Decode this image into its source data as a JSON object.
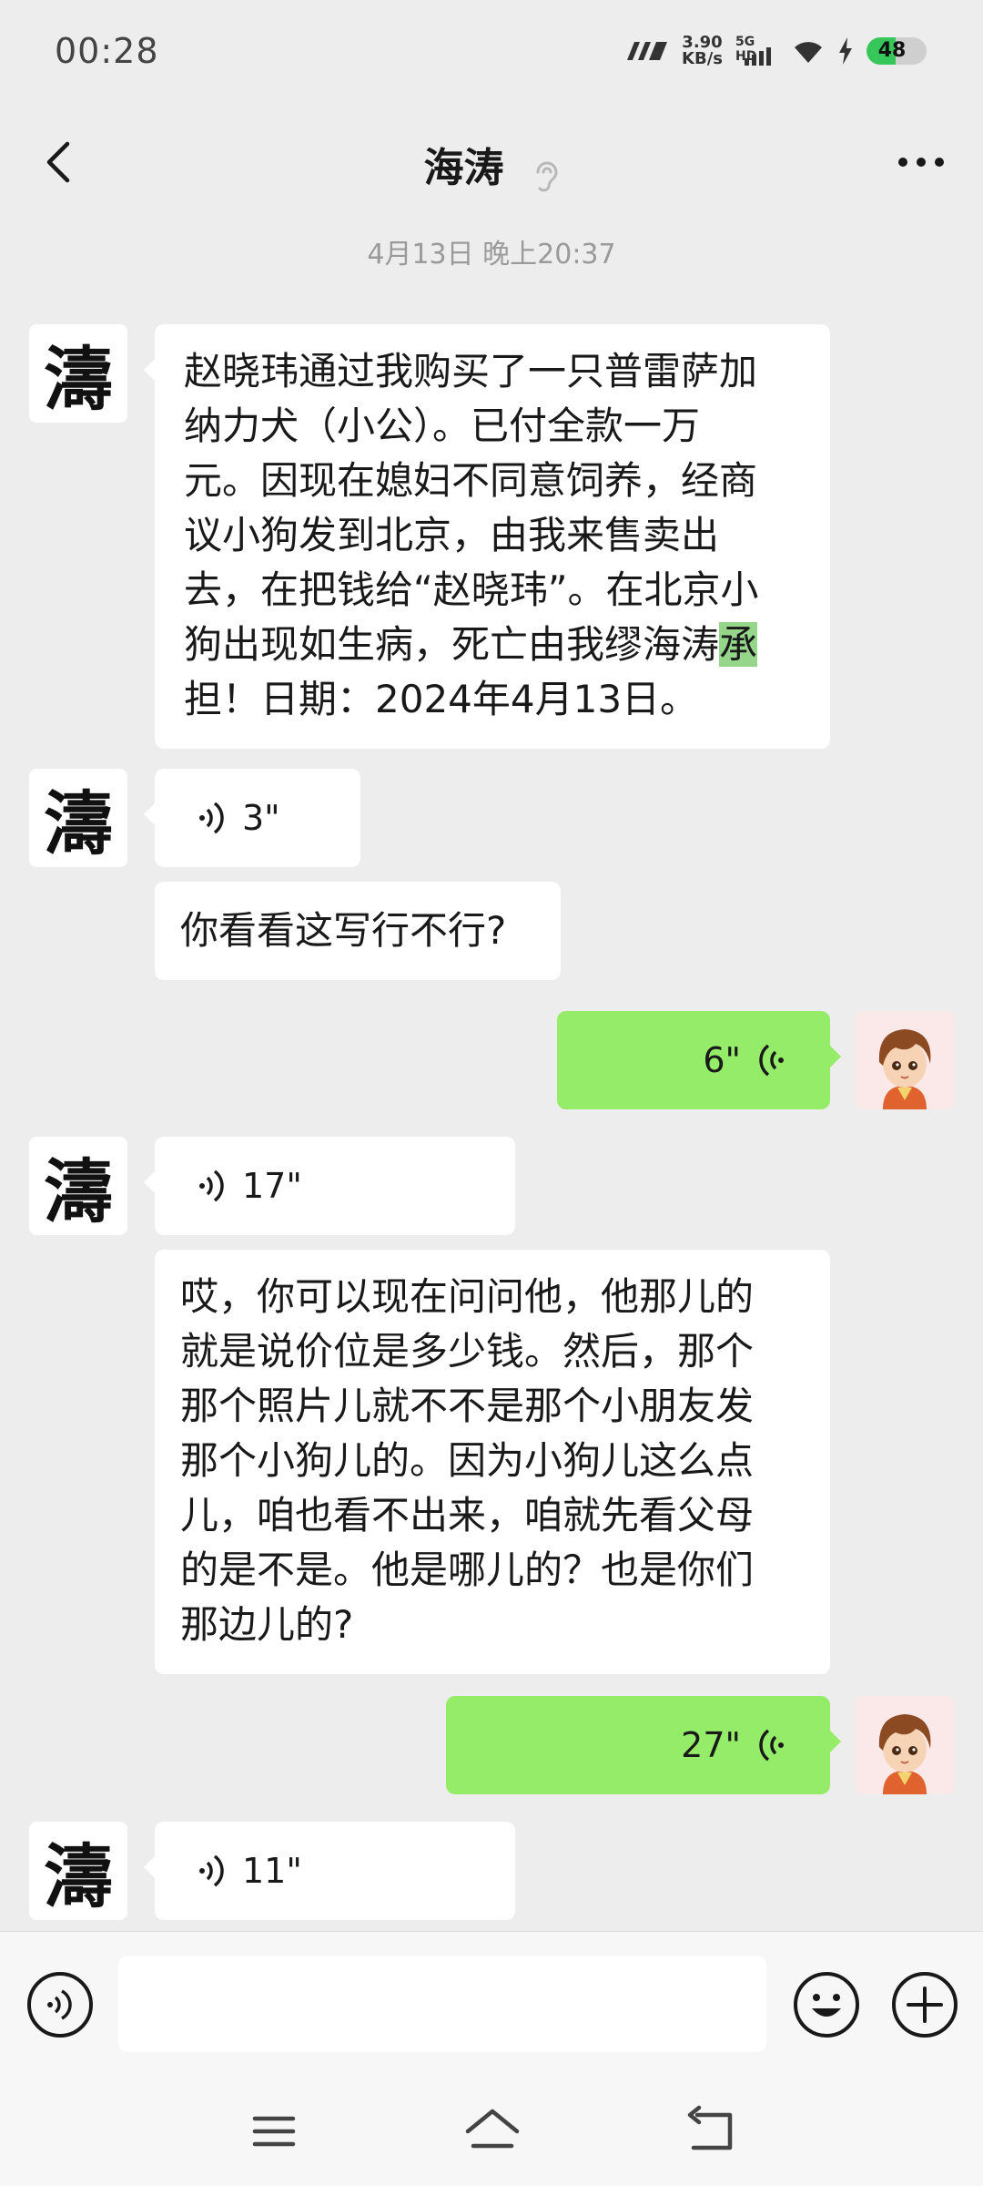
{
  "status_bar": {
    "time": "00:28",
    "net_speed_value": "3.90",
    "net_speed_unit": "KB/s",
    "network_label": "5G HD",
    "battery": "48"
  },
  "header": {
    "title": "海涛"
  },
  "chat": {
    "timestamp": "4月13日 晚上20:37",
    "contact_avatar_char": "濤",
    "messages": [
      {
        "from": "contact",
        "type": "text",
        "lines": [
          "赵晓玮通过我购买了一只普雷萨加",
          "纳力犬（小公）。已付全款一万",
          "元。因现在媳妇不同意饲养，经商",
          "议小狗发到北京，由我来售卖出",
          "去，在把钱给“赵晓玮”。在北京小",
          "狗出现如生病，死亡由我缪海涛"
        ],
        "highlight": "承",
        "last_line": "担！日期：2024年4月13日。"
      },
      {
        "from": "contact",
        "type": "voice",
        "duration": "3\""
      },
      {
        "from": "contact",
        "type": "text",
        "text": "你看看这写行不行?"
      },
      {
        "from": "me",
        "type": "voice",
        "duration": "6\""
      },
      {
        "from": "contact",
        "type": "voice",
        "duration": "17\""
      },
      {
        "from": "contact",
        "type": "text",
        "lines": [
          "哎，你可以现在问问他，他那儿的",
          "就是说价位是多少钱。然后，那个",
          "那个照片儿就不不是那个小朋友发",
          "那个小狗儿的。因为小狗儿这么点",
          "儿，咱也看不出来，咱就先看父母",
          "的是不是。他是哪儿的？也是你们",
          "那边儿的?"
        ]
      },
      {
        "from": "me",
        "type": "voice",
        "duration": "27\""
      },
      {
        "from": "contact",
        "type": "voice",
        "duration": "11\""
      }
    ]
  },
  "input_bar": {
    "text_value": "",
    "icons": [
      "voice-input-icon",
      "emoji-icon",
      "plus-icon"
    ]
  },
  "nav_bar": {
    "icons": [
      "menu-icon",
      "home-icon",
      "back-nav-icon"
    ]
  },
  "colors": {
    "background": "#ededed",
    "my_bubble": "#95ec69",
    "their_bubble": "#ffffff",
    "highlight": "#95d68a"
  }
}
